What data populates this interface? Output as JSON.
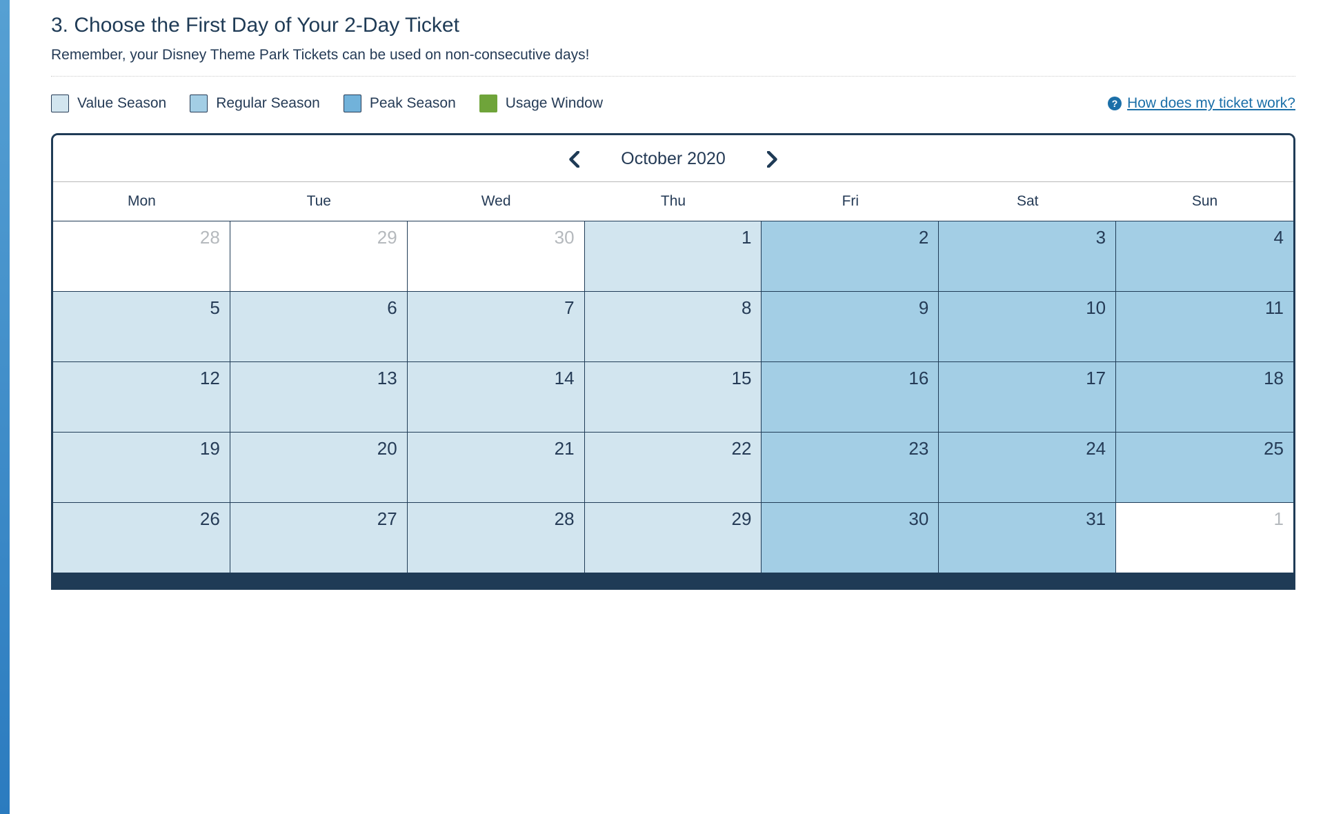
{
  "section": {
    "title": "3. Choose the First Day of Your 2-Day Ticket",
    "subtitle": "Remember, your Disney Theme Park Tickets can be used on non-consecutive days!"
  },
  "legend": {
    "value": "Value Season",
    "regular": "Regular Season",
    "peak": "Peak Season",
    "usage": "Usage Window",
    "help_link": "How does my ticket work?",
    "help_icon": "?"
  },
  "calendar": {
    "month_label": "October 2020",
    "weekdays": [
      "Mon",
      "Tue",
      "Wed",
      "Thu",
      "Fri",
      "Sat",
      "Sun"
    ],
    "days": [
      {
        "n": "28",
        "type": "other"
      },
      {
        "n": "29",
        "type": "other"
      },
      {
        "n": "30",
        "type": "other"
      },
      {
        "n": "1",
        "type": "value"
      },
      {
        "n": "2",
        "type": "regular"
      },
      {
        "n": "3",
        "type": "regular"
      },
      {
        "n": "4",
        "type": "regular"
      },
      {
        "n": "5",
        "type": "value"
      },
      {
        "n": "6",
        "type": "value"
      },
      {
        "n": "7",
        "type": "value"
      },
      {
        "n": "8",
        "type": "value"
      },
      {
        "n": "9",
        "type": "regular"
      },
      {
        "n": "10",
        "type": "regular"
      },
      {
        "n": "11",
        "type": "regular"
      },
      {
        "n": "12",
        "type": "value"
      },
      {
        "n": "13",
        "type": "value"
      },
      {
        "n": "14",
        "type": "value"
      },
      {
        "n": "15",
        "type": "value"
      },
      {
        "n": "16",
        "type": "regular"
      },
      {
        "n": "17",
        "type": "regular"
      },
      {
        "n": "18",
        "type": "regular"
      },
      {
        "n": "19",
        "type": "value"
      },
      {
        "n": "20",
        "type": "value"
      },
      {
        "n": "21",
        "type": "value"
      },
      {
        "n": "22",
        "type": "value"
      },
      {
        "n": "23",
        "type": "regular"
      },
      {
        "n": "24",
        "type": "regular"
      },
      {
        "n": "25",
        "type": "regular"
      },
      {
        "n": "26",
        "type": "value"
      },
      {
        "n": "27",
        "type": "value"
      },
      {
        "n": "28",
        "type": "value"
      },
      {
        "n": "29",
        "type": "value"
      },
      {
        "n": "30",
        "type": "regular"
      },
      {
        "n": "31",
        "type": "regular"
      },
      {
        "n": "1",
        "type": "other"
      }
    ]
  },
  "colors": {
    "value": "#d2e5ef",
    "regular": "#a3cee5",
    "peak": "#71b2da",
    "usage": "#6fa43a",
    "border": "#1f3b56",
    "link": "#1b6fa8"
  }
}
